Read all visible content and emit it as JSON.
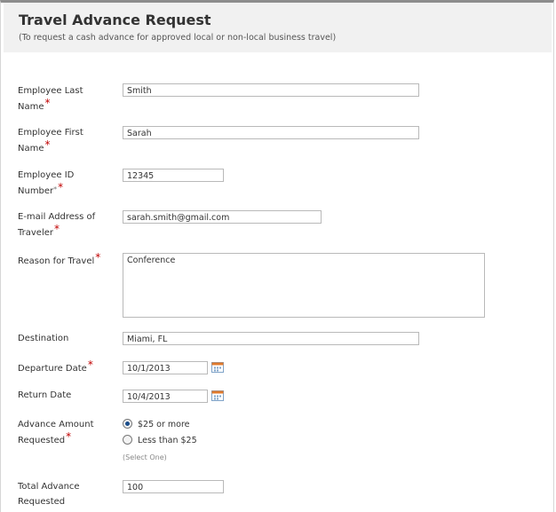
{
  "header": {
    "title": "Travel Advance Request",
    "subtitle": "(To request a cash advance for approved local or non-local business travel)"
  },
  "fields": {
    "last_name": {
      "label": "Employee Last Name",
      "value": "Smith"
    },
    "first_name": {
      "label": "Employee First Name",
      "value": "Sarah"
    },
    "employee_id": {
      "label": "Employee ID Number",
      "small_mark": "*",
      "value": "12345"
    },
    "email": {
      "label": "E-mail Address of Traveler",
      "value": "sarah.smith@gmail.com"
    },
    "reason": {
      "label": "Reason for Travel",
      "value": "Conference"
    },
    "destination": {
      "label": "Destination",
      "value": "Miami, FL"
    },
    "departure": {
      "label": "Departure Date",
      "value": "10/1/2013"
    },
    "return": {
      "label": "Return Date",
      "value": "10/4/2013"
    },
    "advance_amount": {
      "label": "Advance Amount Requested",
      "options": [
        {
          "label": "$25 or more",
          "selected": true
        },
        {
          "label": "Less than $25",
          "selected": false
        }
      ],
      "hint": "(Select One)"
    },
    "total_advance": {
      "label": "Total Advance Requested",
      "value": "100"
    }
  },
  "required_mark": "*",
  "colors": {
    "required": "#c00000",
    "header_bg": "#f1f1f1",
    "radio_selected": "#1a4d8a"
  }
}
